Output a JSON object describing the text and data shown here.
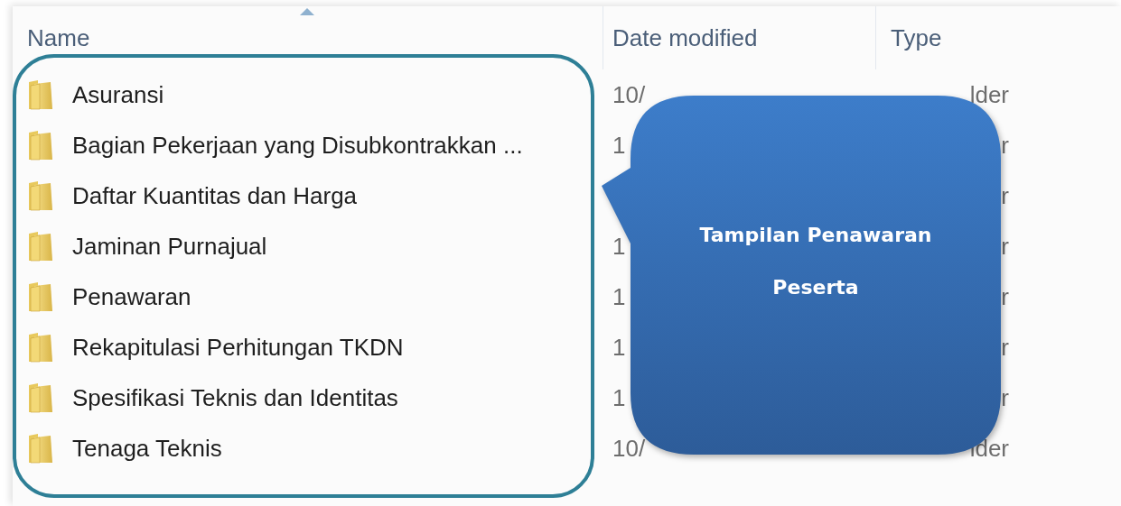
{
  "columns": [
    {
      "label": "Name",
      "sorted": true
    },
    {
      "label": "Date modified",
      "sorted": false
    },
    {
      "label": "Type",
      "sorted": false
    }
  ],
  "rows": [
    {
      "name": "Asuransi",
      "date": "10/",
      "type": "lder"
    },
    {
      "name": "Bagian Pekerjaan yang Disubkontrakkan ...",
      "date": "1",
      "type": "r"
    },
    {
      "name": "Daftar Kuantitas dan Harga",
      "type": "r"
    },
    {
      "name": "Jaminan Purnajual",
      "date": "1",
      "type": "r"
    },
    {
      "name": "Penawaran",
      "date": "1",
      "type": "r"
    },
    {
      "name": "Rekapitulasi Perhitungan TKDN",
      "date": "1",
      "type": "r"
    },
    {
      "name": "Spesifikasi Teknis dan Identitas",
      "date": "1",
      "type": "r"
    },
    {
      "name": "Tenaga Teknis",
      "date": "10/",
      "type": "lder"
    }
  ],
  "callout": {
    "text": "Tampilan Penawaran Peserta"
  }
}
